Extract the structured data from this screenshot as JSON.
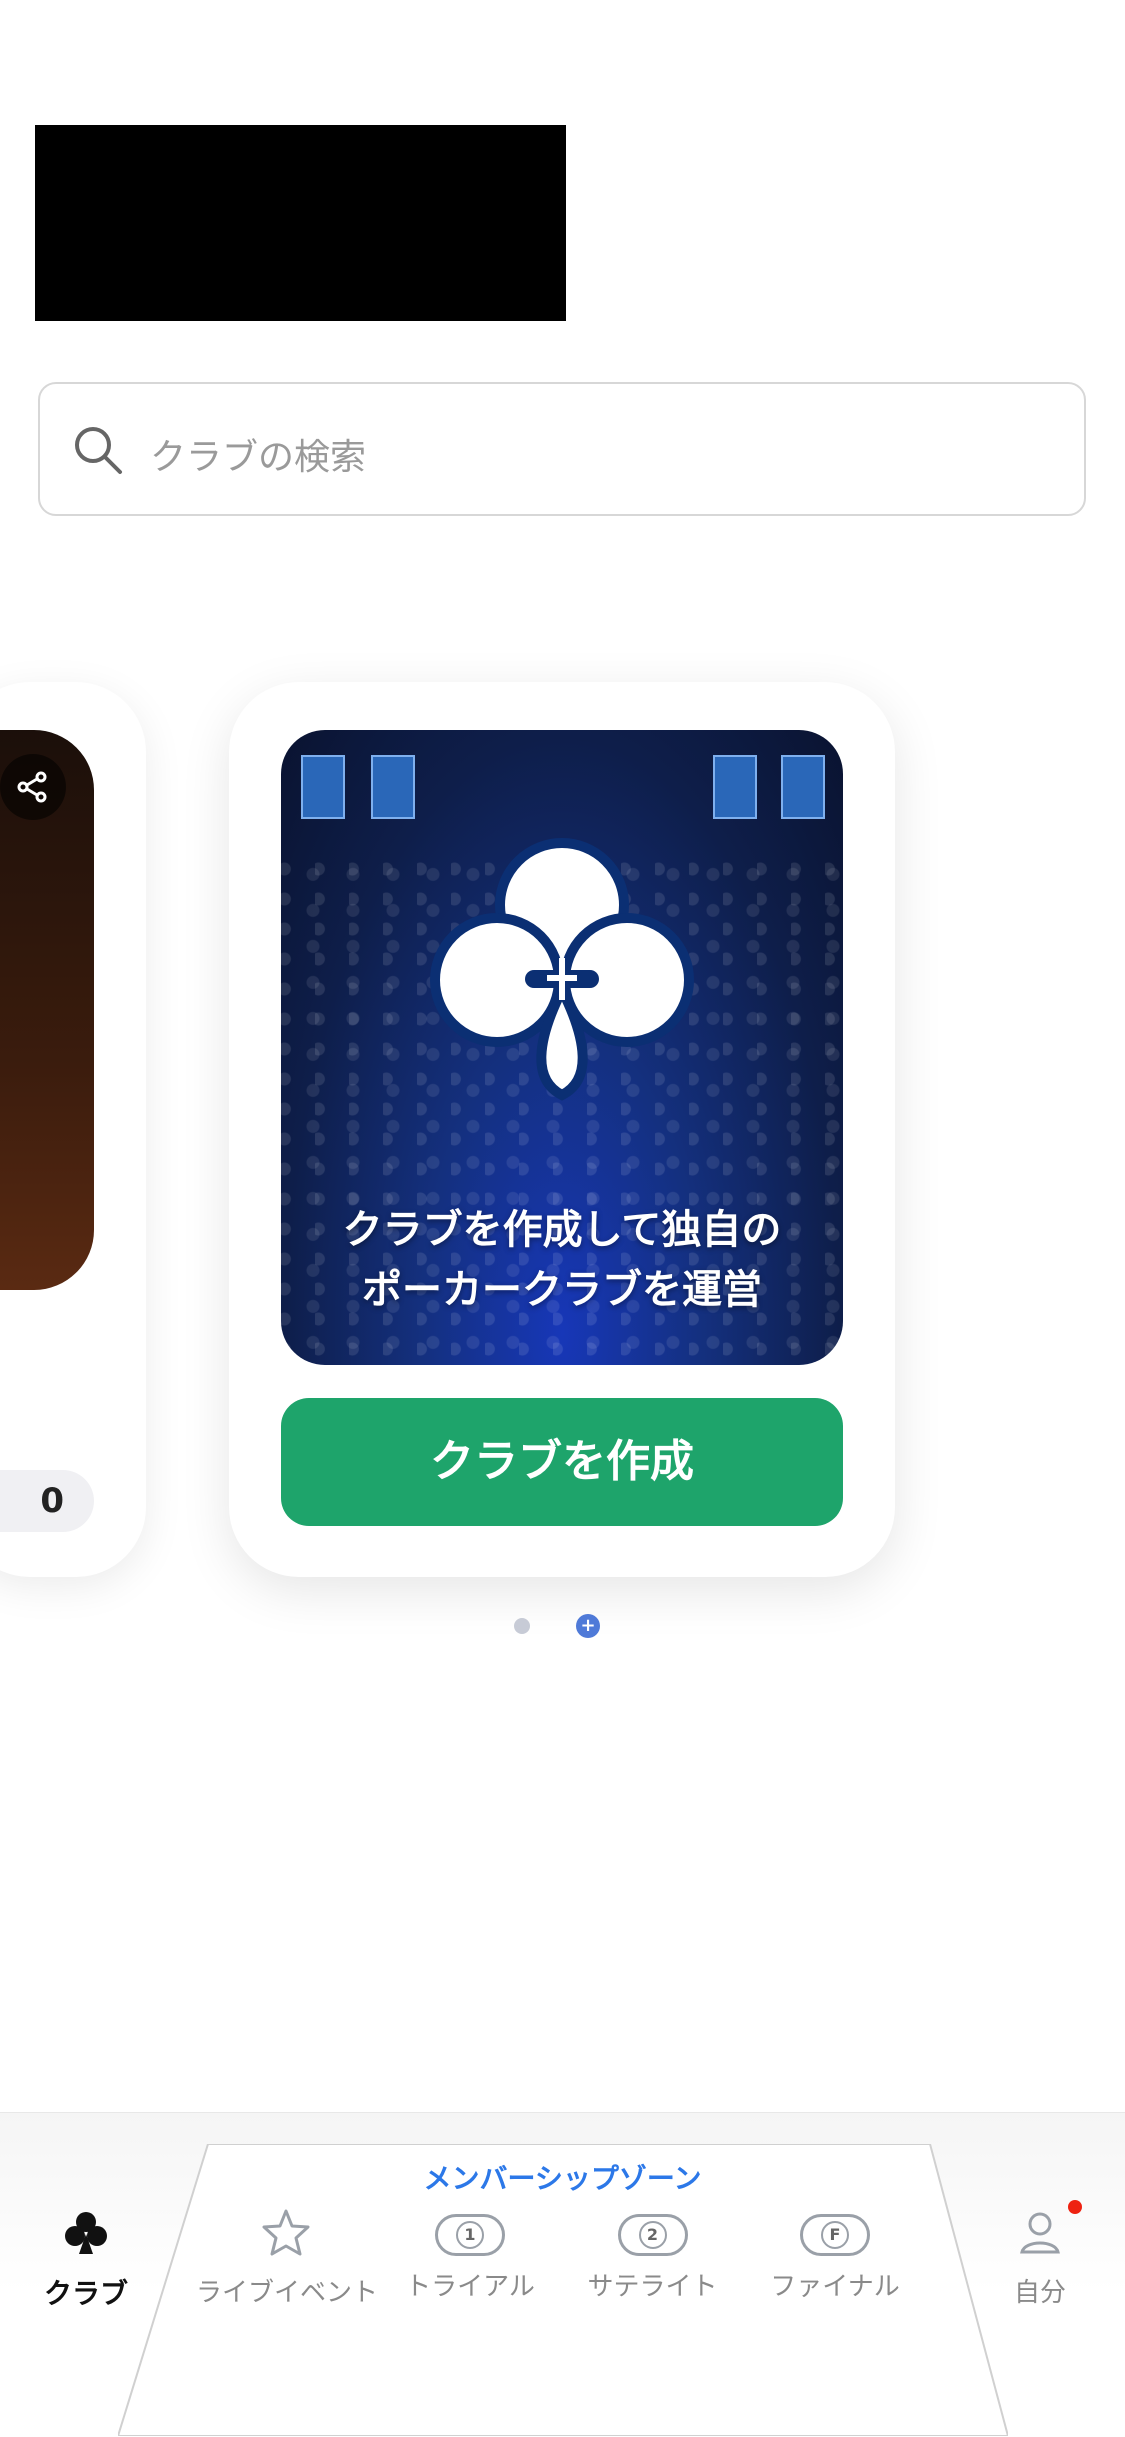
{
  "search": {
    "placeholder": "クラブの検索"
  },
  "carousel": {
    "left_card": {
      "count": "0"
    },
    "main_card": {
      "caption_line1": "クラブを作成して独自の",
      "caption_line2": "ポーカークラブを運営",
      "button_label": "クラブを作成"
    },
    "page_dots": [
      "dot",
      "add-dot"
    ]
  },
  "tabbar": {
    "zone_title": "メンバーシップゾーン",
    "tabs": [
      {
        "label": "クラブ",
        "icon": "club-icon",
        "active": true
      },
      {
        "label": "ライブイベント",
        "icon": "star-icon"
      },
      {
        "label": "トライアル",
        "icon": "badge-1-icon",
        "badge": "1"
      },
      {
        "label": "サテライト",
        "icon": "badge-2-icon",
        "badge": "2"
      },
      {
        "label": "ファイナル",
        "icon": "badge-f-icon",
        "badge": "F"
      },
      {
        "label": "自分",
        "icon": "profile-icon",
        "notification": true
      }
    ]
  },
  "colors": {
    "primary_green": "#1ea46b",
    "accent_blue": "#2c78e8",
    "notification_red": "#ee2211"
  }
}
